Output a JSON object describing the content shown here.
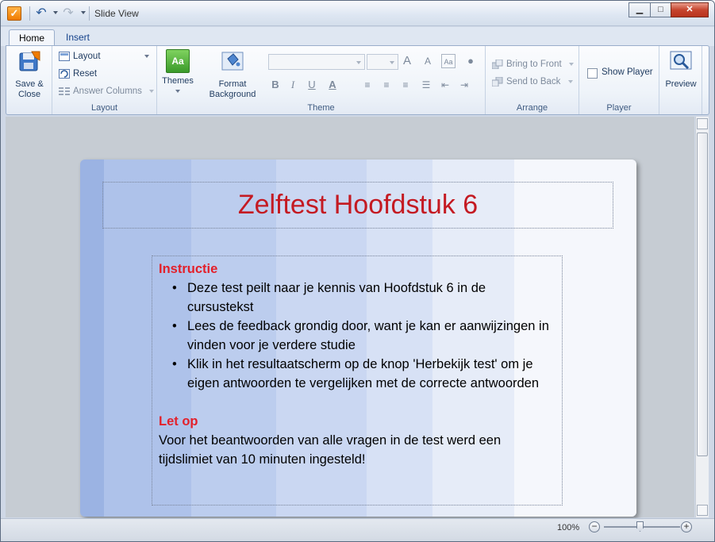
{
  "window": {
    "title": "Slide View",
    "icons": {
      "app": "app-check-icon",
      "undo": "undo-icon",
      "redo": "redo-icon",
      "minimize": "minimize-icon",
      "maximize": "maximize-icon",
      "close": "close-icon"
    }
  },
  "tabs": [
    {
      "label": "Home",
      "active": true
    },
    {
      "label": "Insert",
      "active": false
    }
  ],
  "ribbon": {
    "save": {
      "line1": "Save &",
      "line2": "Close"
    },
    "layout": {
      "layout_label": "Layout",
      "reset_label": "Reset",
      "answer_columns_label": "Answer Columns",
      "group_label": "Layout"
    },
    "theme": {
      "themes_label": "Themes",
      "format_line1": "Format",
      "format_line2": "Background",
      "group_label": "Theme"
    },
    "arrange": {
      "bring_to_front": "Bring to Front",
      "send_to_back": "Send to Back",
      "group_label": "Arrange"
    },
    "player": {
      "show_player_label": "Show Player",
      "show_player_checked": false,
      "group_label": "Player"
    },
    "preview_label": "Preview",
    "theme_icon_text": "Aa"
  },
  "slide": {
    "title": "Zelftest Hoofdstuk 6",
    "instruction_heading": "Instructie",
    "bullets": [
      "Deze test peilt naar je kennis van Hoofdstuk 6 in de cursustekst",
      "Lees de feedback grondig door, want je kan er aanwijzingen in vinden voor je verdere studie",
      "Klik in het resultaatscherm op de knop 'Herbekijk test' om je eigen antwoorden te vergelijken met de correcte antwoorden"
    ],
    "note_heading": "Let op",
    "note_text": "Voor het beantwoorden van alle vragen in de test werd een tijdslimiet van 10 minuten ingesteld!",
    "colors": {
      "title": "#c41a22",
      "heading": "#e3202a"
    }
  },
  "status": {
    "zoom": "100%",
    "zoom_out": "−",
    "zoom_in": "+"
  }
}
